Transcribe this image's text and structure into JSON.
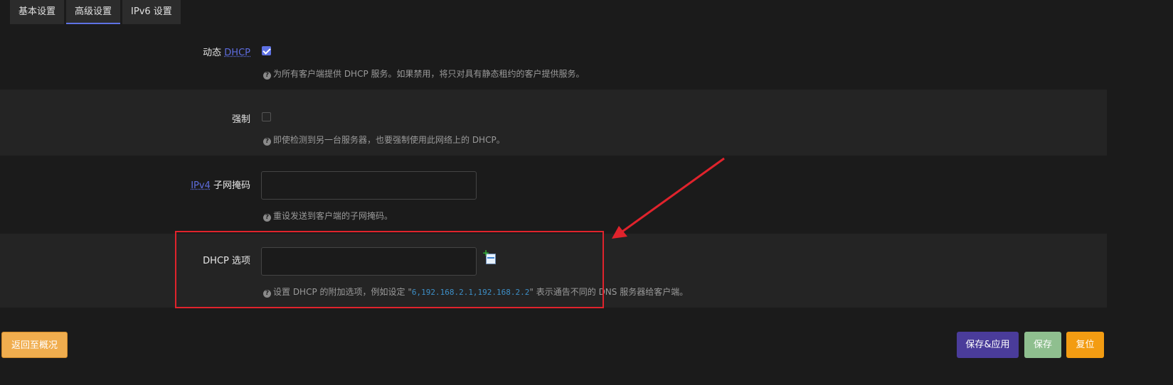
{
  "tabs": [
    {
      "label": "基本设置",
      "active": false
    },
    {
      "label": "高级设置",
      "active": true
    },
    {
      "label": "IPv6 设置",
      "active": false
    }
  ],
  "fields": {
    "dynamic_dhcp": {
      "label_prefix": "动态 ",
      "label_abbr": "DHCP",
      "checked": true,
      "help": "为所有客户端提供 DHCP 服务。如果禁用，将只对具有静态租约的客户提供服务。"
    },
    "force": {
      "label": "强制",
      "checked": false,
      "help": "即使检测到另一台服务器，也要强制使用此网络上的 DHCP。"
    },
    "ipv4_netmask": {
      "label_abbr": "IPv4",
      "label_suffix": " 子网掩码",
      "value": "",
      "help": "重设发送到客户端的子网掩码。"
    },
    "dhcp_options": {
      "label": "DHCP 选项",
      "value": "",
      "help_before": "设置 DHCP 的附加选项，例如设定 \"",
      "help_code": "6,192.168.2.1,192.168.2.2",
      "help_after": "\" 表示通告不同的 DNS 服务器给客户端。"
    }
  },
  "buttons": {
    "back": "返回至概况",
    "save_apply": "保存&应用",
    "save": "保存",
    "reset": "复位"
  },
  "colors": {
    "accent": "#5e72e4",
    "annotation_red": "#e0232c",
    "back_button": "#f0ad4e",
    "save_apply_button": "#4a3c9a",
    "save_button": "#8fbf8f",
    "reset_button": "#f39c12"
  },
  "icons": {
    "help": "question-circle-icon",
    "add": "add-item-icon",
    "checkbox_checked": "check-icon"
  }
}
